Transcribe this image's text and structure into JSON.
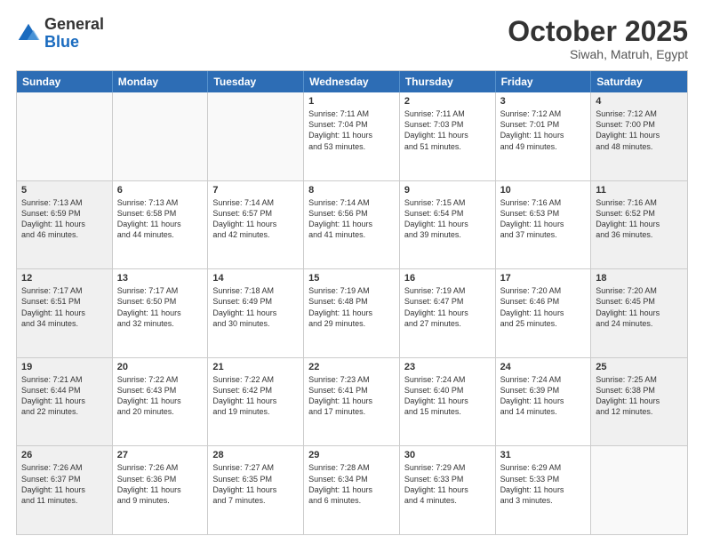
{
  "logo": {
    "general": "General",
    "blue": "Blue"
  },
  "title": "October 2025",
  "subtitle": "Siwah, Matruh, Egypt",
  "days": [
    "Sunday",
    "Monday",
    "Tuesday",
    "Wednesday",
    "Thursday",
    "Friday",
    "Saturday"
  ],
  "weeks": [
    [
      {
        "day": "",
        "info": "",
        "empty": true
      },
      {
        "day": "",
        "info": "",
        "empty": true
      },
      {
        "day": "",
        "info": "",
        "empty": true
      },
      {
        "day": "1",
        "info": "Sunrise: 7:11 AM\nSunset: 7:04 PM\nDaylight: 11 hours\nand 53 minutes.",
        "empty": false,
        "shaded": false
      },
      {
        "day": "2",
        "info": "Sunrise: 7:11 AM\nSunset: 7:03 PM\nDaylight: 11 hours\nand 51 minutes.",
        "empty": false,
        "shaded": false
      },
      {
        "day": "3",
        "info": "Sunrise: 7:12 AM\nSunset: 7:01 PM\nDaylight: 11 hours\nand 49 minutes.",
        "empty": false,
        "shaded": false
      },
      {
        "day": "4",
        "info": "Sunrise: 7:12 AM\nSunset: 7:00 PM\nDaylight: 11 hours\nand 48 minutes.",
        "empty": false,
        "shaded": true
      }
    ],
    [
      {
        "day": "5",
        "info": "Sunrise: 7:13 AM\nSunset: 6:59 PM\nDaylight: 11 hours\nand 46 minutes.",
        "empty": false,
        "shaded": true
      },
      {
        "day": "6",
        "info": "Sunrise: 7:13 AM\nSunset: 6:58 PM\nDaylight: 11 hours\nand 44 minutes.",
        "empty": false,
        "shaded": false
      },
      {
        "day": "7",
        "info": "Sunrise: 7:14 AM\nSunset: 6:57 PM\nDaylight: 11 hours\nand 42 minutes.",
        "empty": false,
        "shaded": false
      },
      {
        "day": "8",
        "info": "Sunrise: 7:14 AM\nSunset: 6:56 PM\nDaylight: 11 hours\nand 41 minutes.",
        "empty": false,
        "shaded": false
      },
      {
        "day": "9",
        "info": "Sunrise: 7:15 AM\nSunset: 6:54 PM\nDaylight: 11 hours\nand 39 minutes.",
        "empty": false,
        "shaded": false
      },
      {
        "day": "10",
        "info": "Sunrise: 7:16 AM\nSunset: 6:53 PM\nDaylight: 11 hours\nand 37 minutes.",
        "empty": false,
        "shaded": false
      },
      {
        "day": "11",
        "info": "Sunrise: 7:16 AM\nSunset: 6:52 PM\nDaylight: 11 hours\nand 36 minutes.",
        "empty": false,
        "shaded": true
      }
    ],
    [
      {
        "day": "12",
        "info": "Sunrise: 7:17 AM\nSunset: 6:51 PM\nDaylight: 11 hours\nand 34 minutes.",
        "empty": false,
        "shaded": true
      },
      {
        "day": "13",
        "info": "Sunrise: 7:17 AM\nSunset: 6:50 PM\nDaylight: 11 hours\nand 32 minutes.",
        "empty": false,
        "shaded": false
      },
      {
        "day": "14",
        "info": "Sunrise: 7:18 AM\nSunset: 6:49 PM\nDaylight: 11 hours\nand 30 minutes.",
        "empty": false,
        "shaded": false
      },
      {
        "day": "15",
        "info": "Sunrise: 7:19 AM\nSunset: 6:48 PM\nDaylight: 11 hours\nand 29 minutes.",
        "empty": false,
        "shaded": false
      },
      {
        "day": "16",
        "info": "Sunrise: 7:19 AM\nSunset: 6:47 PM\nDaylight: 11 hours\nand 27 minutes.",
        "empty": false,
        "shaded": false
      },
      {
        "day": "17",
        "info": "Sunrise: 7:20 AM\nSunset: 6:46 PM\nDaylight: 11 hours\nand 25 minutes.",
        "empty": false,
        "shaded": false
      },
      {
        "day": "18",
        "info": "Sunrise: 7:20 AM\nSunset: 6:45 PM\nDaylight: 11 hours\nand 24 minutes.",
        "empty": false,
        "shaded": true
      }
    ],
    [
      {
        "day": "19",
        "info": "Sunrise: 7:21 AM\nSunset: 6:44 PM\nDaylight: 11 hours\nand 22 minutes.",
        "empty": false,
        "shaded": true
      },
      {
        "day": "20",
        "info": "Sunrise: 7:22 AM\nSunset: 6:43 PM\nDaylight: 11 hours\nand 20 minutes.",
        "empty": false,
        "shaded": false
      },
      {
        "day": "21",
        "info": "Sunrise: 7:22 AM\nSunset: 6:42 PM\nDaylight: 11 hours\nand 19 minutes.",
        "empty": false,
        "shaded": false
      },
      {
        "day": "22",
        "info": "Sunrise: 7:23 AM\nSunset: 6:41 PM\nDaylight: 11 hours\nand 17 minutes.",
        "empty": false,
        "shaded": false
      },
      {
        "day": "23",
        "info": "Sunrise: 7:24 AM\nSunset: 6:40 PM\nDaylight: 11 hours\nand 15 minutes.",
        "empty": false,
        "shaded": false
      },
      {
        "day": "24",
        "info": "Sunrise: 7:24 AM\nSunset: 6:39 PM\nDaylight: 11 hours\nand 14 minutes.",
        "empty": false,
        "shaded": false
      },
      {
        "day": "25",
        "info": "Sunrise: 7:25 AM\nSunset: 6:38 PM\nDaylight: 11 hours\nand 12 minutes.",
        "empty": false,
        "shaded": true
      }
    ],
    [
      {
        "day": "26",
        "info": "Sunrise: 7:26 AM\nSunset: 6:37 PM\nDaylight: 11 hours\nand 11 minutes.",
        "empty": false,
        "shaded": true
      },
      {
        "day": "27",
        "info": "Sunrise: 7:26 AM\nSunset: 6:36 PM\nDaylight: 11 hours\nand 9 minutes.",
        "empty": false,
        "shaded": false
      },
      {
        "day": "28",
        "info": "Sunrise: 7:27 AM\nSunset: 6:35 PM\nDaylight: 11 hours\nand 7 minutes.",
        "empty": false,
        "shaded": false
      },
      {
        "day": "29",
        "info": "Sunrise: 7:28 AM\nSunset: 6:34 PM\nDaylight: 11 hours\nand 6 minutes.",
        "empty": false,
        "shaded": false
      },
      {
        "day": "30",
        "info": "Sunrise: 7:29 AM\nSunset: 6:33 PM\nDaylight: 11 hours\nand 4 minutes.",
        "empty": false,
        "shaded": false
      },
      {
        "day": "31",
        "info": "Sunrise: 6:29 AM\nSunset: 5:33 PM\nDaylight: 11 hours\nand 3 minutes.",
        "empty": false,
        "shaded": false
      },
      {
        "day": "",
        "info": "",
        "empty": true
      }
    ]
  ]
}
